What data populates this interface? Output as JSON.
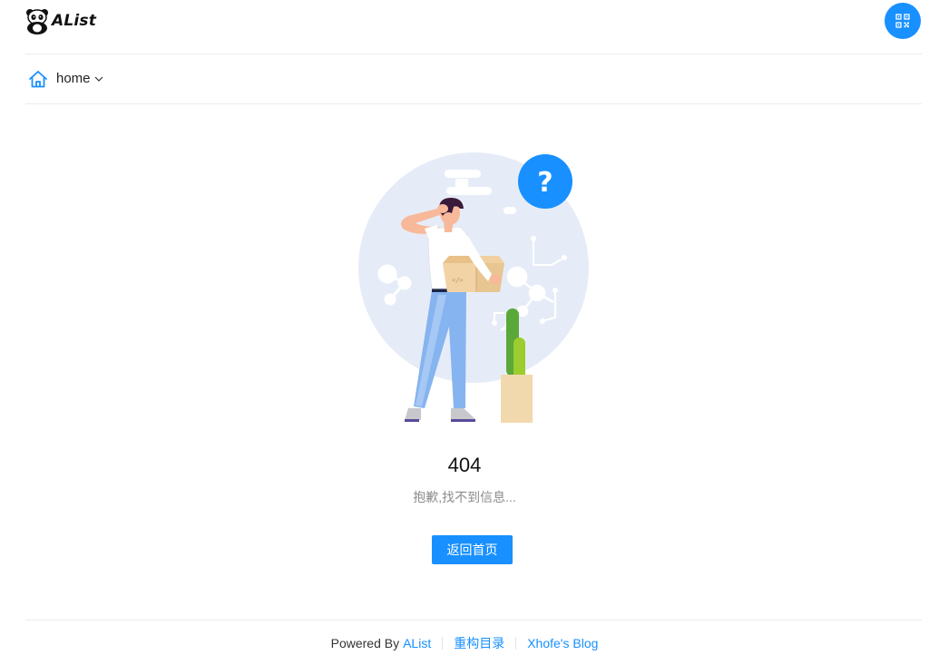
{
  "header": {
    "logo_text": "AList",
    "qr_icon": "qrcode-icon"
  },
  "breadcrumb": {
    "home_icon": "home-icon",
    "current": "home",
    "chevron_icon": "chevron-down-icon"
  },
  "error": {
    "code": "404",
    "message": "抱歉,找不到信息...",
    "back_label": "返回首页",
    "illustration_badge": "?"
  },
  "footer": {
    "powered_by": "Powered By",
    "alist_link": "AList",
    "rebuild_link": "重构目录",
    "blog_link": "Xhofe's Blog"
  },
  "colors": {
    "accent": "#1890ff",
    "divider": "#ececec",
    "muted_text": "#8c8c8c"
  }
}
